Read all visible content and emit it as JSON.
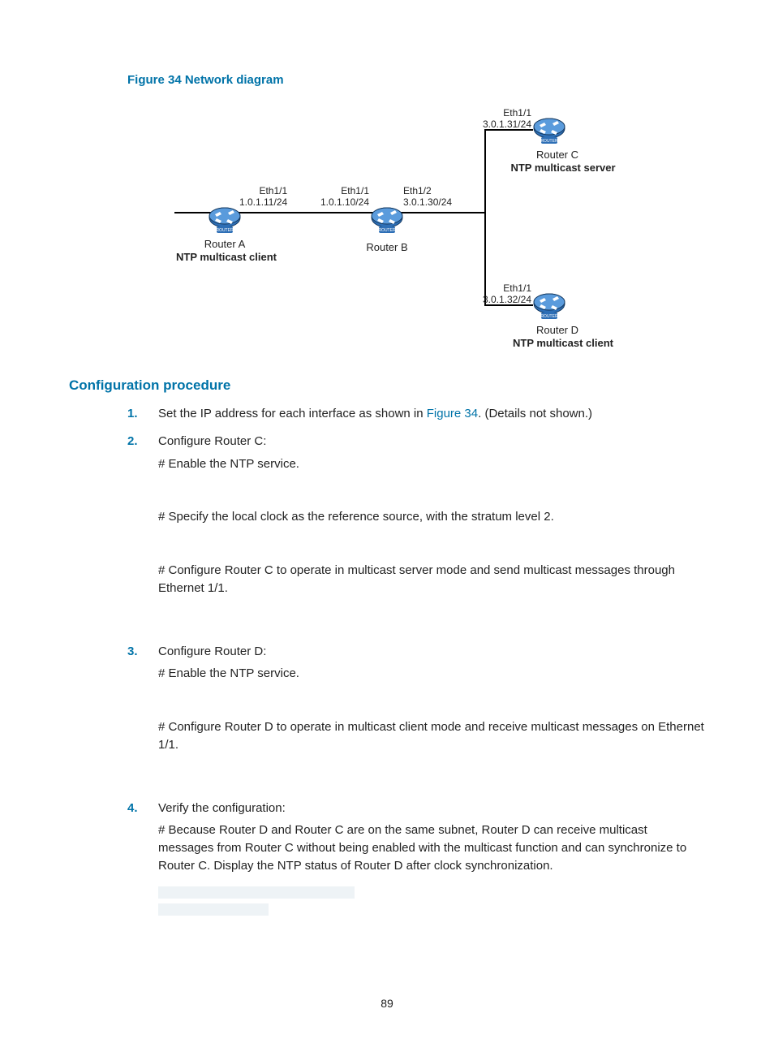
{
  "figure": {
    "caption": "Figure 34 Network diagram",
    "routerA": {
      "if_line1": "Eth1/1",
      "if_line2": "1.0.1.11/24",
      "name": "Router A",
      "role": "NTP multicast client"
    },
    "routerB": {
      "if1_line1": "Eth1/1",
      "if1_line2": "1.0.1.10/24",
      "if2_line1": "Eth1/2",
      "if2_line2": "3.0.1.30/24",
      "name": "Router B"
    },
    "routerC": {
      "if_line1": "Eth1/1",
      "if_line2": "3.0.1.31/24",
      "name": "Router C",
      "role": "NTP multicast server"
    },
    "routerD": {
      "if_line1": "Eth1/1",
      "if_line2": "3.0.1.32/24",
      "name": "Router D",
      "role": "NTP multicast client"
    }
  },
  "section_heading": "Configuration procedure",
  "steps": {
    "s1_pre": "Set the IP address for each interface as shown in ",
    "s1_link": "Figure 34",
    "s1_post": ". (Details not shown.)",
    "s2_main": "Configure Router C:",
    "s2_a": "# Enable the NTP service.",
    "s2_b": "# Specify the local clock as the reference source, with the stratum level 2.",
    "s2_c": "# Configure Router C to operate in multicast server mode and send multicast messages through Ethernet 1/1.",
    "s3_main": "Configure Router D:",
    "s3_a": "# Enable the NTP service.",
    "s3_b": "# Configure Router D to operate in multicast client mode and receive multicast messages on Ethernet 1/1.",
    "s4_main": "Verify the configuration:",
    "s4_a": "# Because Router D and Router C are on the same subnet, Router D can receive multicast messages from Router C without being enabled with the multicast function and can synchronize to Router C. Display the NTP status of Router D after clock synchronization."
  },
  "page_number": "89"
}
